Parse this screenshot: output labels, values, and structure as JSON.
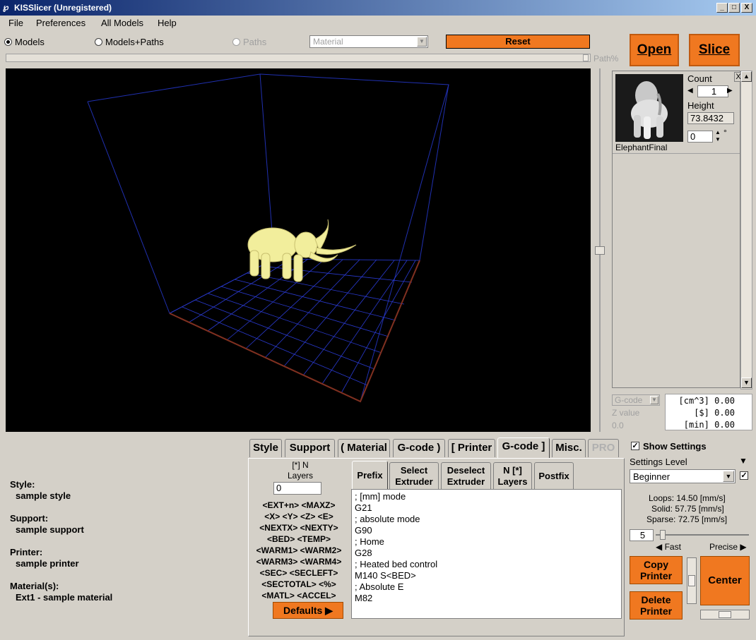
{
  "window": {
    "title": "KISSlicer (Unregistered)",
    "min": "_",
    "max": "□",
    "close": "X"
  },
  "menu": [
    "File",
    "Preferences",
    "All Models",
    "Help"
  ],
  "view": {
    "models": "Models",
    "models_paths": "Models+Paths",
    "paths": "Paths",
    "material_placeholder": "Material",
    "reset": "Reset",
    "path_label": "Path%"
  },
  "actions": {
    "open": "Open",
    "slice": "Slice"
  },
  "model": {
    "name": "ElephantFinal",
    "count_label": "Count",
    "count": "1",
    "height_label": "Height",
    "height": "73.8432",
    "rotation": "0",
    "degree": "°",
    "remove": "X"
  },
  "stats": {
    "select": "G-code",
    "zvalue_label": "Z value",
    "zvalue": "0.0",
    "rows": [
      "[cm^3] 0.00",
      "[$] 0.00",
      "[min] 0.00"
    ]
  },
  "tabs": [
    "Style",
    "Support",
    "( Material",
    "G-code )",
    "[ Printer",
    "G-code ]",
    "Misc.",
    "PRO"
  ],
  "subtabs": [
    "Prefix",
    "Select Extruder",
    "Deselect Extruder",
    "N [*] Layers",
    "Postfix"
  ],
  "layers": {
    "label": "[*] N Layers",
    "value": "0"
  },
  "macros": [
    "<EXT+n> <MAXZ>",
    "<X> <Y> <Z> <E>",
    "<NEXTX> <NEXTY>",
    "<BED> <TEMP>",
    "<WARM1> <WARM2>",
    "<WARM3> <WARM4>",
    "<SEC> <SECLEFT>",
    "<SECTOTAL> <%>",
    "<MATL> <ACCEL>"
  ],
  "defaults_button": "Defaults",
  "gcode_lines": [
    "; [mm] mode",
    "G21",
    "; absolute mode",
    "G90",
    "; Home",
    "G28",
    "; Heated bed control",
    "M140 S<BED>",
    "; Absolute E",
    "M82"
  ],
  "summary": {
    "style_label": "Style:",
    "style": "sample style",
    "support_label": "Support:",
    "support": "sample support",
    "printer_label": "Printer:",
    "printer": "sample printer",
    "material_label": "Material(s):",
    "material": "Ext1 - sample material"
  },
  "settings": {
    "show_settings": "Show Settings",
    "level_label": "Settings Level",
    "level": "Beginner",
    "loops": "Loops:  14.50 [mm/s]",
    "solid": "Solid:  57.75 [mm/s]",
    "sparse": "Sparse: 72.75 [mm/s]",
    "speed_value": "5",
    "fast": "Fast",
    "precise": "Precise",
    "copy_printer": "Copy Printer",
    "delete_printer": "Delete Printer",
    "center": "Center"
  }
}
